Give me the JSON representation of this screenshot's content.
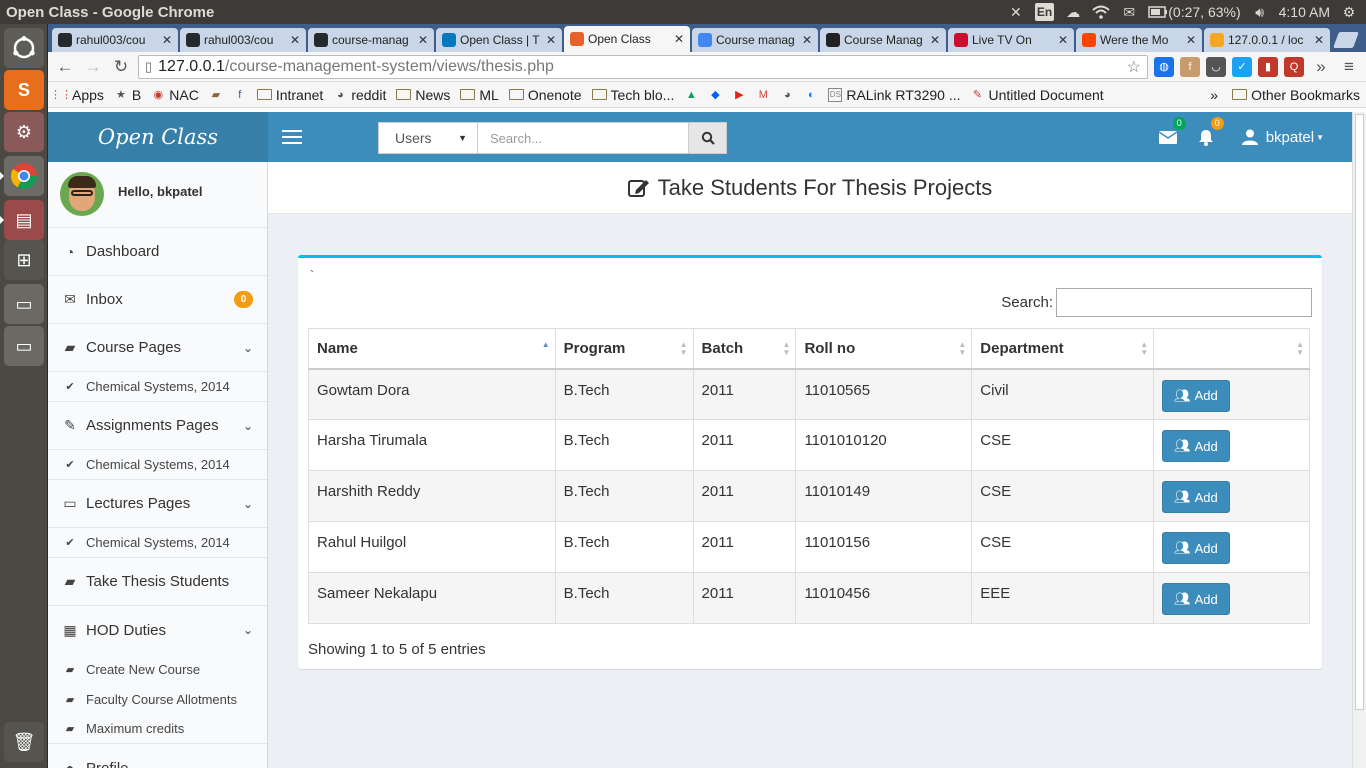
{
  "os": {
    "window_title": "Open Class - Google Chrome",
    "lang": "En",
    "battery": "(0:27, 63%)",
    "clock": "4:10 AM"
  },
  "tabs": [
    {
      "label": "rahul003/cou",
      "icon": "github-icon",
      "color": "#24292e"
    },
    {
      "label": "rahul003/cou",
      "icon": "github-icon",
      "color": "#24292e"
    },
    {
      "label": "course-manag",
      "icon": "github-icon",
      "color": "#24292e"
    },
    {
      "label": "Open Class | T",
      "icon": "trello-icon",
      "color": "#0079bf"
    },
    {
      "label": "Open Class",
      "icon": "openclass-icon",
      "color": "#e8632b",
      "active": true
    },
    {
      "label": "Course manag",
      "icon": "google-icon",
      "color": "#4285f4"
    },
    {
      "label": "Course Manag",
      "icon": "v-icon",
      "color": "#222222"
    },
    {
      "label": "Live TV On",
      "icon": "ibn-icon",
      "color": "#c8102e"
    },
    {
      "label": "Were the Mo",
      "icon": "reddit-icon",
      "color": "#ff4500"
    },
    {
      "label": "127.0.0.1 / loc",
      "icon": "pma-icon",
      "color": "#f5a623"
    }
  ],
  "address": {
    "host": "127.0.0.1",
    "path": "/course-management-system/views/thesis.php"
  },
  "bookmarks": {
    "items": [
      {
        "label": "Apps",
        "icon": "apps-icon"
      },
      {
        "label": "B",
        "icon": "star-icon"
      },
      {
        "label": "NAC",
        "icon": "nac-icon"
      },
      {
        "label": "",
        "icon": "book-icon"
      },
      {
        "label": "",
        "icon": "facebook-icon"
      },
      {
        "label": "Intranet",
        "icon": "folder-icon"
      },
      {
        "label": "reddit",
        "icon": "reddit-icon"
      },
      {
        "label": "News",
        "icon": "folder-icon"
      },
      {
        "label": "ML",
        "icon": "folder-icon"
      },
      {
        "label": "Onenote",
        "icon": "folder-icon"
      },
      {
        "label": "Tech blo...",
        "icon": "folder-icon"
      },
      {
        "label": "",
        "icon": "drive-icon"
      },
      {
        "label": "",
        "icon": "dropbox-icon"
      },
      {
        "label": "",
        "icon": "youtube-icon"
      },
      {
        "label": "",
        "icon": "gmail-icon"
      },
      {
        "label": "",
        "icon": "reddit-icon"
      },
      {
        "label": "",
        "icon": "speed-icon"
      },
      {
        "label": "RALink RT3290 ...",
        "icon": "ds-icon"
      },
      {
        "label": "Untitled Document",
        "icon": "doc-icon"
      }
    ],
    "more": "»",
    "other": "Other Bookmarks"
  },
  "app": {
    "logo": "Open Class",
    "search_select": "Users",
    "search_placeholder": "Search...",
    "mail_count": "0",
    "notif_count": "0",
    "username": "bkpatel",
    "hello": "Hello, bkpatel"
  },
  "sidebar": {
    "dashboard": "Dashboard",
    "inbox": "Inbox",
    "inbox_count": "0",
    "course_pages": "Course Pages",
    "course_sub": "Chemical Systems, 2014",
    "assignments_pages": "Assignments Pages",
    "assignments_sub": "Chemical Systems, 2014",
    "lectures_pages": "Lectures Pages",
    "lectures_sub": "Chemical Systems, 2014",
    "take_thesis": "Take Thesis Students",
    "hod_duties": "HOD Duties",
    "hod_sub1": "Create New Course",
    "hod_sub2": "Faculty Course Allotments",
    "hod_sub3": "Maximum credits",
    "profile": "Profile"
  },
  "content": {
    "title": "Take Students For Thesis Projects",
    "tick": "`",
    "search_label": "Search:",
    "columns": [
      "Name",
      "Program",
      "Batch",
      "Roll no",
      "Department",
      ""
    ],
    "rows": [
      {
        "name": "Gowtam Dora",
        "program": "B.Tech",
        "batch": "2011",
        "roll": "11010565",
        "dept": "Civil",
        "action": "Add"
      },
      {
        "name": "Harsha Tirumala",
        "program": "B.Tech",
        "batch": "2011",
        "roll": "1101010120",
        "dept": "CSE",
        "action": "Add"
      },
      {
        "name": "Harshith Reddy",
        "program": "B.Tech",
        "batch": "2011",
        "roll": "11010149",
        "dept": "CSE",
        "action": "Add"
      },
      {
        "name": "Rahul Huilgol",
        "program": "B.Tech",
        "batch": "2011",
        "roll": "11010156",
        "dept": "CSE",
        "action": "Add"
      },
      {
        "name": "Sameer Nekalapu",
        "program": "B.Tech",
        "batch": "2011",
        "roll": "11010456",
        "dept": "EEE",
        "action": "Add"
      }
    ],
    "info": "Showing 1 to 5 of 5 entries"
  }
}
